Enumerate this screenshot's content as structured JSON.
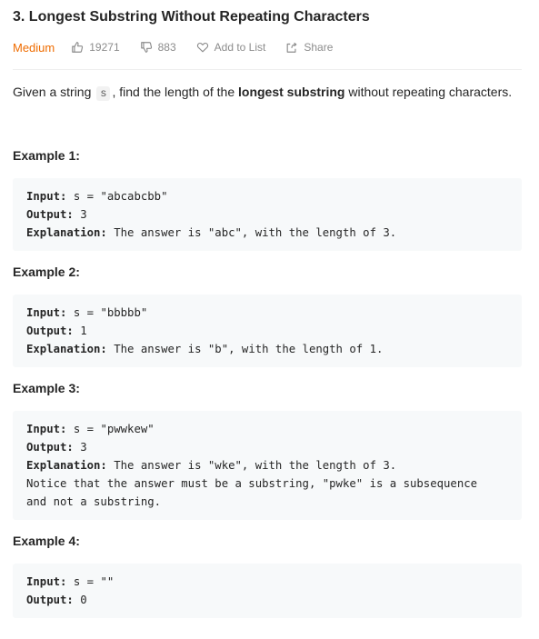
{
  "problem": {
    "title": "3. Longest Substring Without Repeating Characters",
    "difficulty": "Medium",
    "likes": "19271",
    "dislikes": "883",
    "add_to_list_label": "Add to List",
    "share_label": "Share"
  },
  "description": {
    "part1": "Given a string",
    "code": "s",
    "part2": ", find the length of the",
    "bold": "longest substring",
    "part3": "without repeating characters."
  },
  "labels": {
    "input": "Input:",
    "output": "Output:",
    "explanation": "Explanation:"
  },
  "examples": [
    {
      "title": "Example 1:",
      "input": "s = \"abcabcbb\"",
      "output": "3",
      "explanation": "The answer is \"abc\", with the length of 3."
    },
    {
      "title": "Example 2:",
      "input": "s = \"bbbbb\"",
      "output": "1",
      "explanation": "The answer is \"b\", with the length of 1."
    },
    {
      "title": "Example 3:",
      "input": "s = \"pwwkew\"",
      "output": "3",
      "explanation": "The answer is \"wke\", with the length of 3.",
      "note_line1": "Notice that the answer must be a substring, \"pwke\" is a subsequence",
      "note_line2": "and not a substring."
    },
    {
      "title": "Example 4:",
      "input": "s = \"\"",
      "output": "0"
    }
  ],
  "colors": {
    "difficulty_medium": "#ef6c00",
    "code_block_bg": "#f7f9fa",
    "muted_text": "#8c8c8c"
  },
  "icons": {
    "like": "thumbs-up-icon",
    "dislike": "thumbs-down-icon",
    "add_to_list": "heart-icon",
    "share": "share-icon"
  }
}
